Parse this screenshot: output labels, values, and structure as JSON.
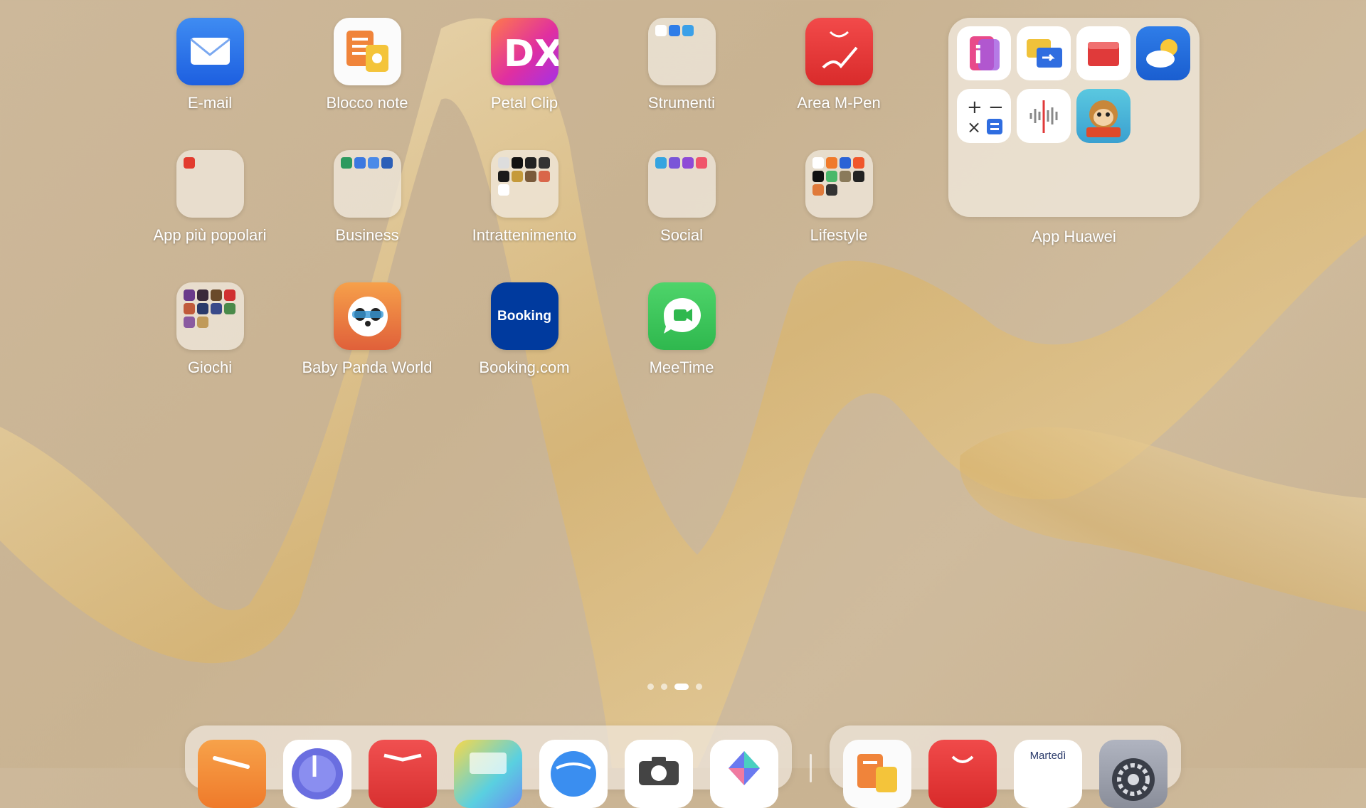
{
  "home": {
    "apps": [
      {
        "label": "E-mail",
        "icon": "mail-icon"
      },
      {
        "label": "Blocco note",
        "icon": "notepad-icon"
      },
      {
        "label": "Petal Clip",
        "icon": "petal-clip-icon"
      },
      {
        "label": "Strumenti",
        "icon": "folder-icon"
      },
      {
        "label": "Area M-Pen",
        "icon": "m-pen-icon"
      },
      {
        "label": "App più popolari",
        "icon": "folder-icon"
      },
      {
        "label": "Business",
        "icon": "folder-icon"
      },
      {
        "label": "Intrattenimento",
        "icon": "folder-icon"
      },
      {
        "label": "Social",
        "icon": "folder-icon"
      },
      {
        "label": "Lifestyle",
        "icon": "folder-icon"
      },
      {
        "label": "Giochi",
        "icon": "folder-icon"
      },
      {
        "label": "Baby Panda World",
        "icon": "panda-icon"
      },
      {
        "label": "Booking.com",
        "icon": "booking-icon",
        "text": "Booking"
      },
      {
        "label": "MeeTime",
        "icon": "meetime-icon"
      }
    ],
    "huawei_folder": {
      "label": "App Huawei",
      "apps": [
        "tips-icon",
        "phone-clone-icon",
        "huawei-box-icon",
        "weather-icon",
        "calculator-icon",
        "voice-recorder-icon",
        "kids-monkey-icon"
      ]
    }
  },
  "pager": {
    "pages": 4,
    "active": 2
  },
  "dock": {
    "apps": [
      "send-icon",
      "music-icon",
      "books-icon",
      "gallery-icon",
      "browser-icon",
      "camera-icon",
      "themes-icon"
    ],
    "recent": [
      "notepad-icon",
      "appgallery-icon",
      "calendar-icon",
      "settings-icon"
    ],
    "calendar_day": "Martedì"
  },
  "colors": {
    "label": "#ffffff",
    "folder": "#f0e8dc",
    "wallpaper": "#cdb89a"
  }
}
